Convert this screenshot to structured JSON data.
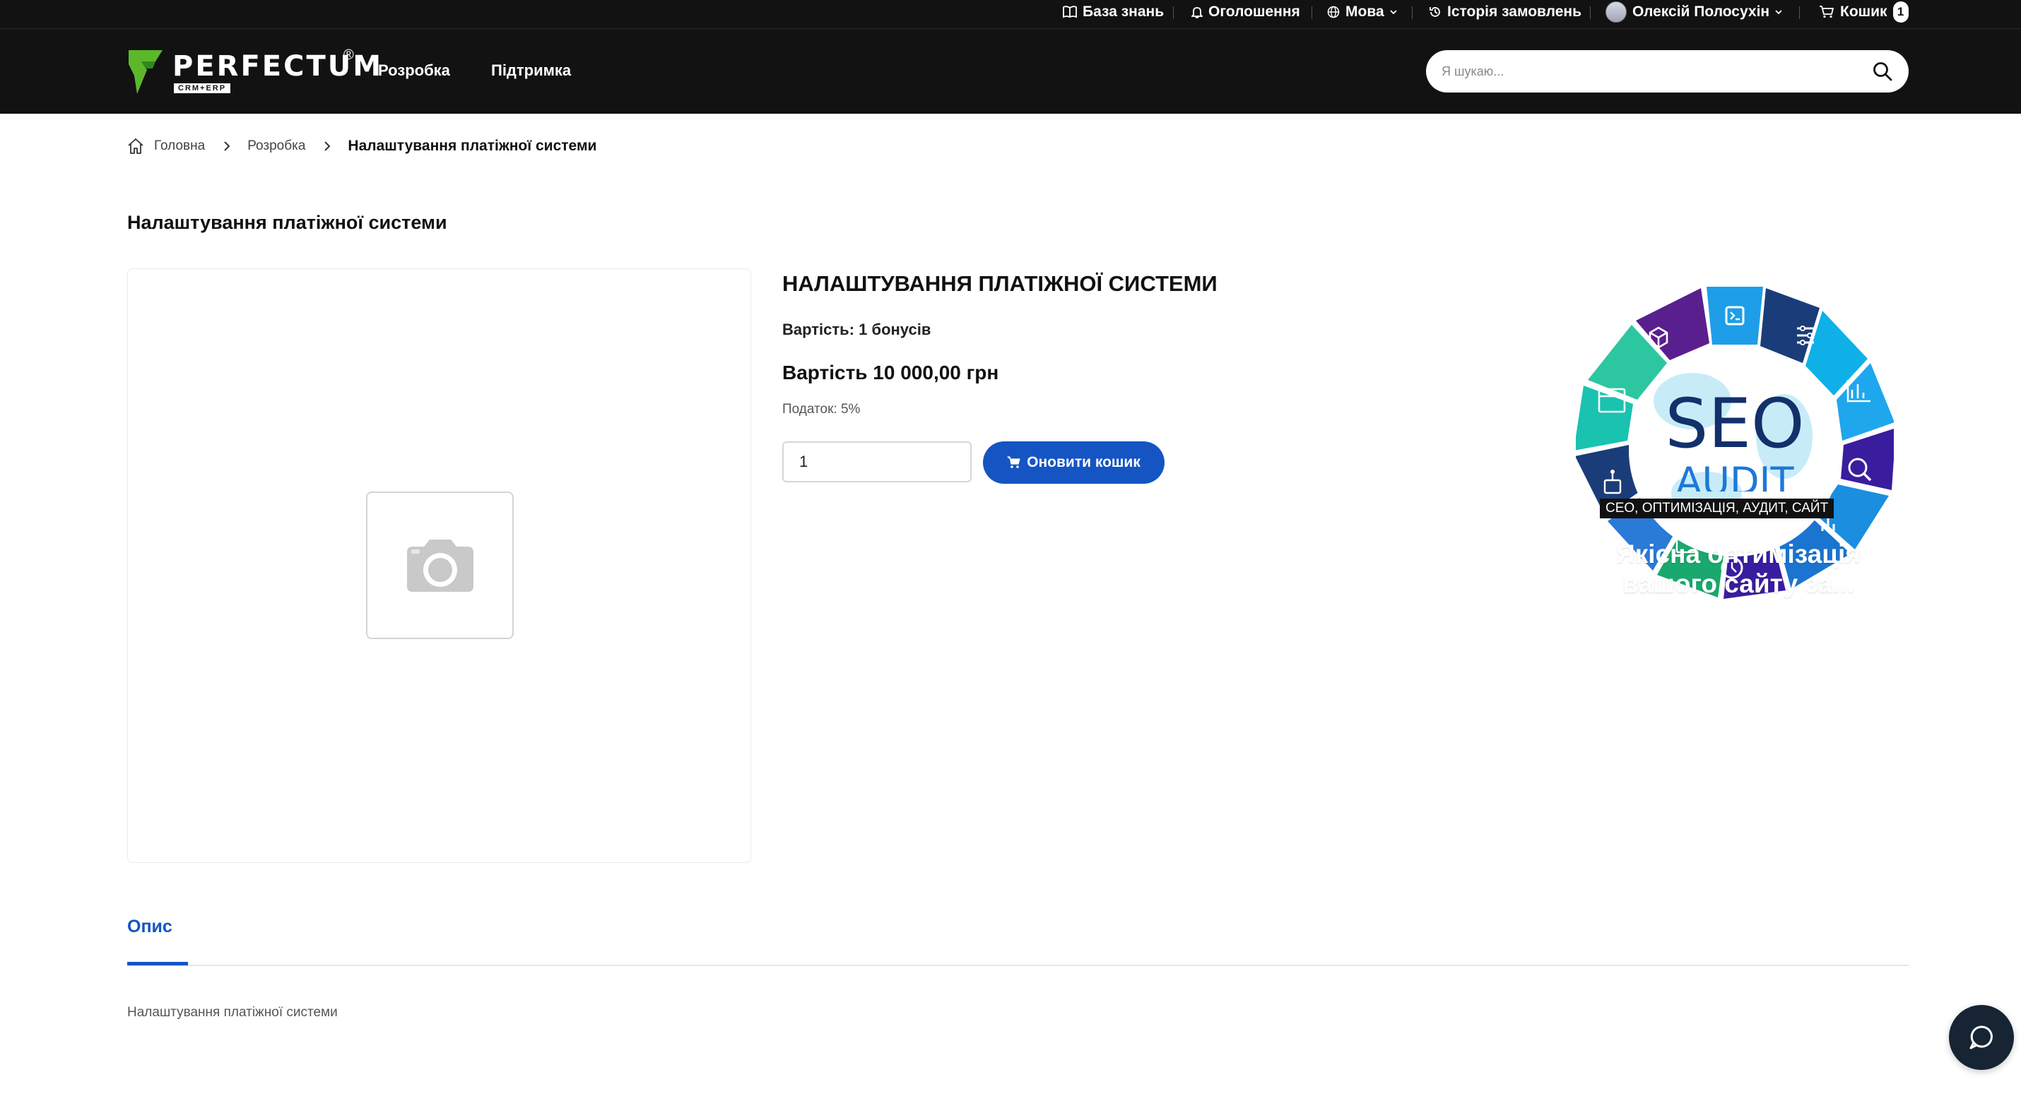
{
  "topbar": {
    "knowledge_base": "База знань",
    "announcements": "Оголошення",
    "language": "Мова",
    "order_history": "Історія замовлень",
    "user_name": "Олексій Полосухін",
    "cart_label": "Кошик",
    "cart_count": "1"
  },
  "header": {
    "logo_text": "PERFECTUM",
    "logo_sub": "CRM+ERP",
    "logo_reg": "®",
    "nav": [
      "Розробка",
      "Підтримка"
    ],
    "search_placeholder": "Я шукаю..."
  },
  "breadcrumb": {
    "home": "Головна",
    "category": "Розробка",
    "current": "Налаштування платіжної системи"
  },
  "page": {
    "title": "Налаштування платіжної системи"
  },
  "product": {
    "name": "НАЛАШТУВАННЯ ПЛАТІЖНОЇ СИСТЕМИ",
    "bonus": "Вартість: 1 бонусів",
    "price": "Вартість 10 000,00 грн",
    "tax": "Податок: 5%",
    "quantity": "1",
    "update_button": "Оновити кошик"
  },
  "promo": {
    "seo_text": "SEO",
    "audit_text": "AUDIT",
    "tag": "СЕО, ОПТИМІЗАЦІЯ, АУДИТ, САЙТ",
    "headline_line1": "Якісна оптимізація",
    "headline_line2": "вашого сайту за..."
  },
  "tabs": {
    "description_tab": "Опис",
    "description_text": "Налаштування платіжної системи"
  },
  "colors": {
    "header_bg": "#121212",
    "accent_blue": "#1455c3",
    "logo_green": "#5cb82a",
    "chat_bg": "#162433"
  }
}
